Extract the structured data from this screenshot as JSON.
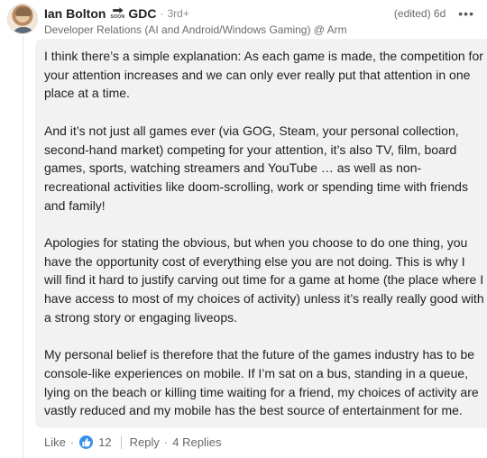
{
  "author": {
    "name": "Ian Bolton",
    "badge_text": "SOON",
    "suffix": "GDC",
    "degree": "3rd+",
    "headline": "Developer Relations (AI and Android/Windows Gaming) @ Arm"
  },
  "meta": {
    "edited": "(edited) 6d",
    "more": "•••"
  },
  "comment": {
    "paragraphs": [
      "I think there’s a simple explanation: As each game is made, the competition for your attention increases and we can only ever really put that attention in one place at a time.",
      "And it’s not just all games ever (via GOG, Steam, your personal collection, second-hand market) competing for your attention, it’s also TV, film, board games, sports, watching streamers and YouTube … as well as non-recreational activities like doom-scrolling, work or spending time with friends and family!",
      "Apologies for stating the obvious, but when you choose to do one thing, you have the opportunity cost of everything else you are not doing. This is why I will find it hard to justify carving out time for a game at home (the place where I have access to most of my choices of activity) unless it’s really really good with a strong story or engaging liveops.",
      "My personal belief is therefore that the future of the games industry has to be console-like experiences on mobile. If I’m sat on a bus, standing in a queue, lying on the beach or killing time waiting for a friend, my choices of activity are vastly reduced and my mobile has the best source of entertainment for me."
    ]
  },
  "actions": {
    "like": "Like",
    "dot": "·",
    "like_count": "12",
    "reply": "Reply",
    "replies": "4 Replies"
  },
  "colors": {
    "like_blue": "#378fe9",
    "comment_bg": "#f2f2f2"
  },
  "icons": {
    "like": "thumbs-up-icon",
    "more": "more-options-icon",
    "soon": "arrow-right-icon"
  }
}
